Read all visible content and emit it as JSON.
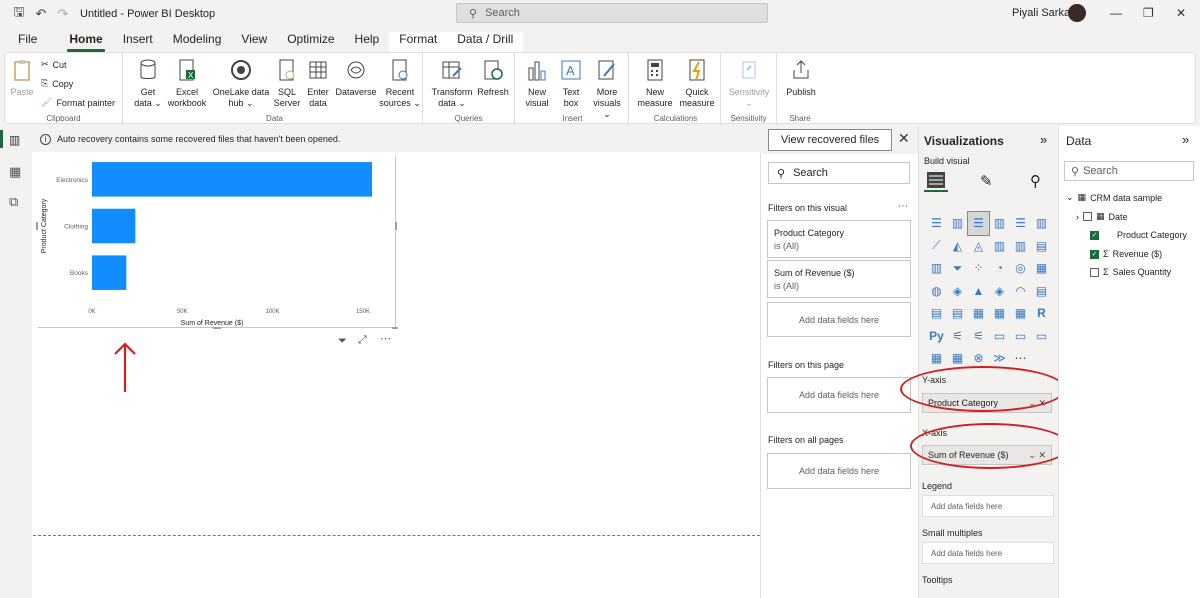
{
  "titlebar": {
    "app_title": "Untitled - Power BI Desktop",
    "search_placeholder": "Search",
    "user_name": "Piyali Sarkar"
  },
  "tabs": [
    "File",
    "Home",
    "Insert",
    "Modeling",
    "View",
    "Optimize",
    "Help",
    "Format",
    "Data / Drill"
  ],
  "active_tab": "Home",
  "ribbon": {
    "clipboard": {
      "paste": "Paste",
      "cut": "Cut",
      "copy": "Copy",
      "format_painter": "Format painter",
      "label": "Clipboard"
    },
    "data": {
      "label": "Data",
      "buttons": [
        {
          "l1": "Get",
          "l2": "data ⌄"
        },
        {
          "l1": "Excel",
          "l2": "workbook"
        },
        {
          "l1": "OneLake data",
          "l2": "hub ⌄"
        },
        {
          "l1": "SQL",
          "l2": "Server"
        },
        {
          "l1": "Enter",
          "l2": "data"
        },
        {
          "l1": "Dataverse",
          "l2": ""
        },
        {
          "l1": "Recent",
          "l2": "sources ⌄"
        }
      ]
    },
    "queries": {
      "label": "Queries",
      "buttons": [
        {
          "l1": "Transform",
          "l2": "data ⌄"
        },
        {
          "l1": "Refresh",
          "l2": ""
        }
      ]
    },
    "insert": {
      "label": "Insert",
      "buttons": [
        {
          "l1": "New",
          "l2": "visual"
        },
        {
          "l1": "Text",
          "l2": "box"
        },
        {
          "l1": "More",
          "l2": "visuals ⌄"
        }
      ]
    },
    "calculations": {
      "label": "Calculations",
      "buttons": [
        {
          "l1": "New",
          "l2": "measure"
        },
        {
          "l1": "Quick",
          "l2": "measure"
        }
      ]
    },
    "sensitivity": {
      "label": "Sensitivity",
      "buttons": [
        {
          "l1": "Sensitivity",
          "l2": "⌄"
        }
      ]
    },
    "share": {
      "label": "Share",
      "buttons": [
        {
          "l1": "Publish",
          "l2": ""
        }
      ]
    }
  },
  "recovery": {
    "message": "Auto recovery contains some recovered files that haven't been opened.",
    "button": "View recovered files"
  },
  "chart_data": {
    "type": "bar",
    "orientation": "horizontal",
    "categories": [
      "Electronics",
      "Clothing",
      "Books"
    ],
    "values": [
      155000,
      24000,
      19000
    ],
    "xlabel": "Sum of Revenue ($)",
    "ylabel": "Product Category",
    "xlim": [
      0,
      155000
    ],
    "xticks": [
      0,
      50000,
      100000,
      150000
    ],
    "xtick_labels": [
      "0K",
      "50K",
      "100K",
      "150K"
    ],
    "bar_color": "#118dff"
  },
  "filters": {
    "search": "Search",
    "on_visual": "Filters on this visual",
    "cards": [
      {
        "title": "Product Category",
        "sub": "is (All)"
      },
      {
        "title": "Sum of Revenue ($)",
        "sub": "is (All)"
      }
    ],
    "add_fields": "Add data fields here",
    "on_page": "Filters on this page",
    "on_all_pages": "Filters on all pages"
  },
  "visualizations": {
    "title": "Visualizations",
    "build_visual": "Build visual",
    "y_axis": "Y-axis",
    "y_value": "Product Category",
    "x_axis": "X-axis",
    "x_value": "Sum of Revenue ($)",
    "legend": "Legend",
    "small_multiples": "Small multiples",
    "tooltips": "Tooltips",
    "add_fields": "Add data fields here",
    "r_label": "R",
    "py_label": "Py"
  },
  "data_pane": {
    "title": "Data",
    "search": "Search",
    "table": "CRM data sample",
    "fields": [
      {
        "name": "Date",
        "checked": false
      },
      {
        "name": "Product Category",
        "checked": true
      },
      {
        "name": "Revenue ($)",
        "checked": true
      },
      {
        "name": "Sales Quantity",
        "checked": false
      }
    ]
  },
  "colors": {
    "accent": "#1b6b3a",
    "bar": "#118dff",
    "annotation": "#d21f1f"
  }
}
